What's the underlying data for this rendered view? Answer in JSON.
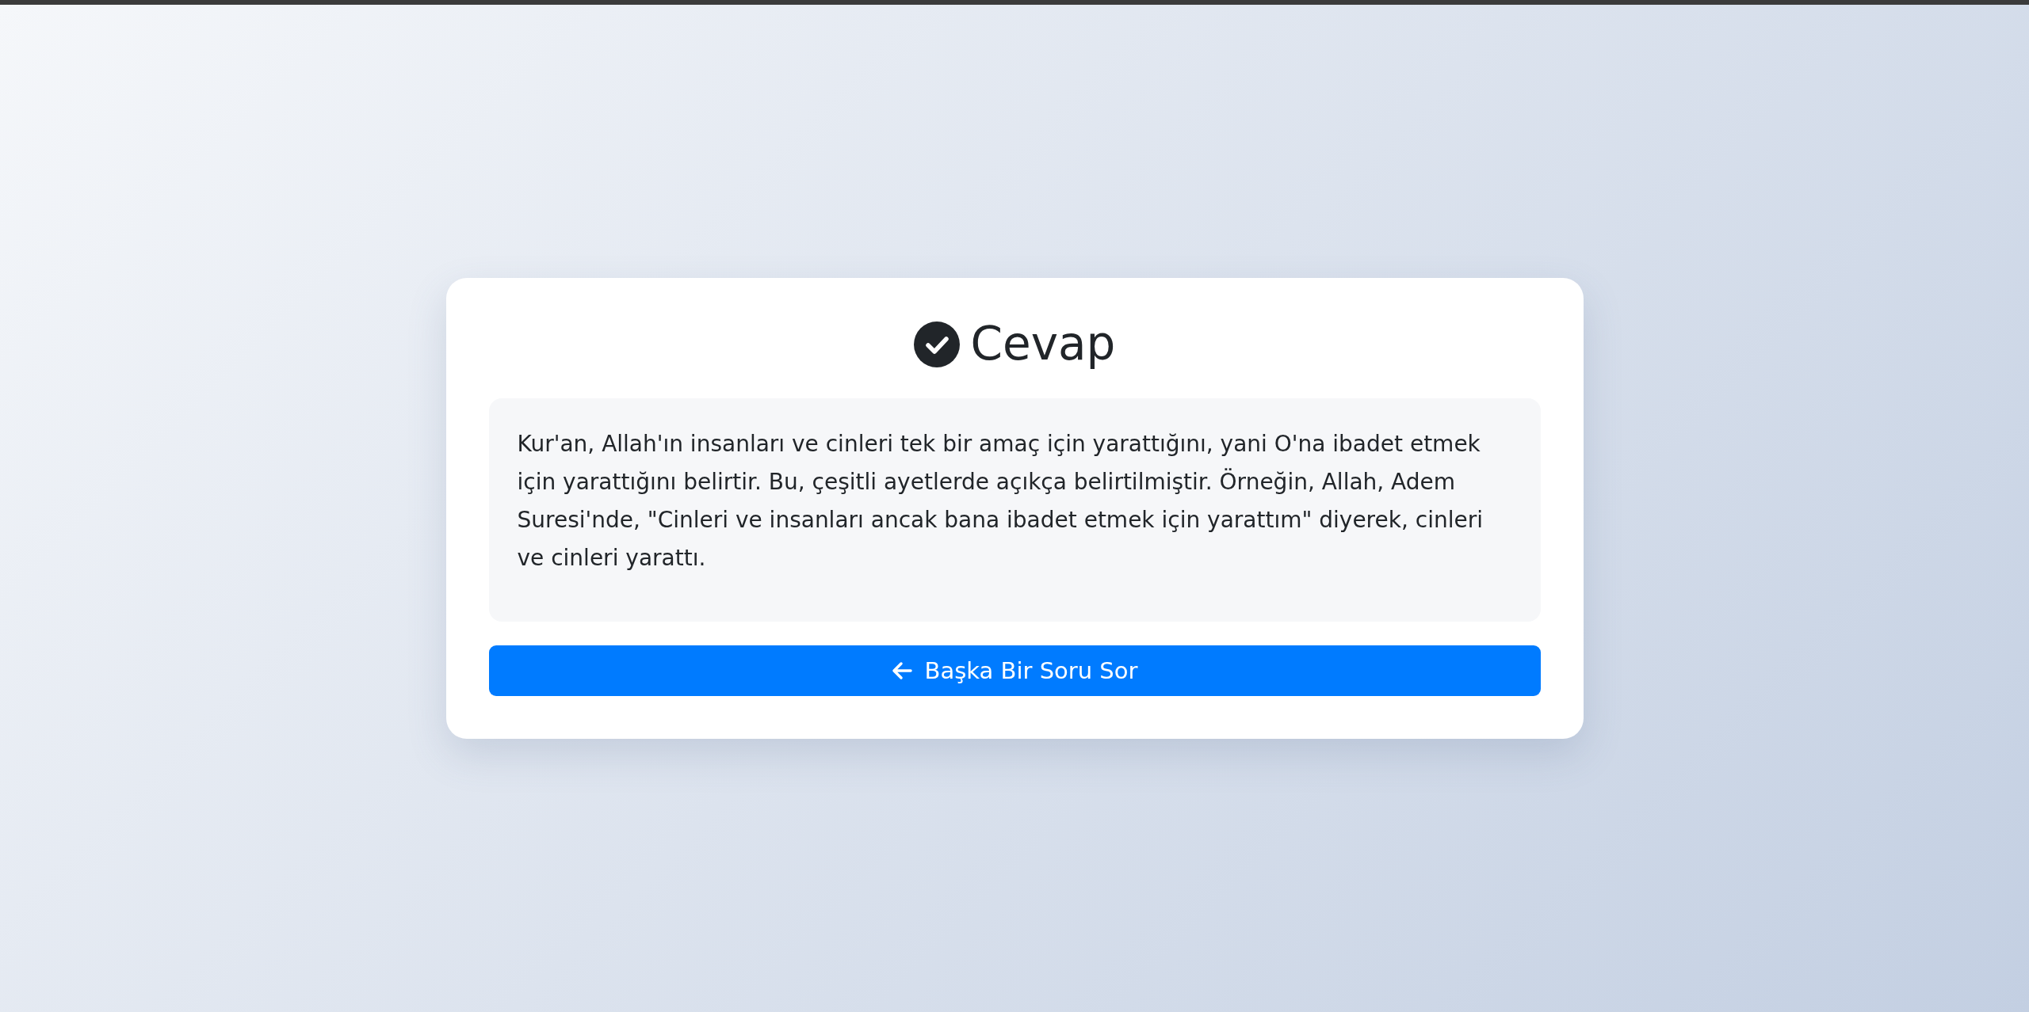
{
  "card": {
    "title": "Cevap",
    "answer": "Kur'an, Allah'ın insanları ve cinleri tek bir amaç için yarattığını, yani O'na ibadet etmek için yarattığını belirtir. Bu, çeşitli ayetlerde açıkça belirtilmiştir. Örneğin, Allah, Adem Suresi'nde, \"Cinleri ve insanları ancak bana ibadet etmek için yarattım\" diyerek, cinleri ve cinleri yarattı.",
    "button": "Başka Bir Soru Sor"
  }
}
